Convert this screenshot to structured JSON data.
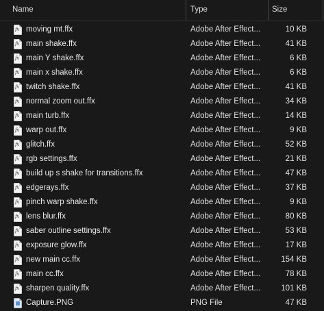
{
  "columns": {
    "name": "Name",
    "type": "Type",
    "size": "Size"
  },
  "files": [
    {
      "name": "moving mt.ffx",
      "type": "Adobe After Effect...",
      "size": "10 KB",
      "icon": "ffx-file-icon"
    },
    {
      "name": "main shake.ffx",
      "type": "Adobe After Effect...",
      "size": "41 KB",
      "icon": "ffx-file-icon"
    },
    {
      "name": "main Y shake.ffx",
      "type": "Adobe After Effect...",
      "size": "6 KB",
      "icon": "ffx-file-icon"
    },
    {
      "name": "main x shake.ffx",
      "type": "Adobe After Effect...",
      "size": "6 KB",
      "icon": "ffx-file-icon"
    },
    {
      "name": "twitch shake.ffx",
      "type": "Adobe After Effect...",
      "size": "41 KB",
      "icon": "ffx-file-icon"
    },
    {
      "name": "normal zoom out.ffx",
      "type": "Adobe After Effect...",
      "size": "34 KB",
      "icon": "ffx-file-icon"
    },
    {
      "name": "main turb.ffx",
      "type": "Adobe After Effect...",
      "size": "14 KB",
      "icon": "ffx-file-icon"
    },
    {
      "name": "warp out.ffx",
      "type": "Adobe After Effect...",
      "size": "9 KB",
      "icon": "ffx-file-icon"
    },
    {
      "name": "glitch.ffx",
      "type": "Adobe After Effect...",
      "size": "52 KB",
      "icon": "ffx-file-icon"
    },
    {
      "name": "rgb settings.ffx",
      "type": "Adobe After Effect...",
      "size": "21 KB",
      "icon": "ffx-file-icon"
    },
    {
      "name": "build up s shake for transitions.ffx",
      "type": "Adobe After Effect...",
      "size": "47 KB",
      "icon": "ffx-file-icon"
    },
    {
      "name": "edgerays.ffx",
      "type": "Adobe After Effect...",
      "size": "37 KB",
      "icon": "ffx-file-icon"
    },
    {
      "name": "pinch warp shake.ffx",
      "type": "Adobe After Effect...",
      "size": "9 KB",
      "icon": "ffx-file-icon"
    },
    {
      "name": "lens blur.ffx",
      "type": "Adobe After Effect...",
      "size": "80 KB",
      "icon": "ffx-file-icon"
    },
    {
      "name": "saber outline settings.ffx",
      "type": "Adobe After Effect...",
      "size": "53 KB",
      "icon": "ffx-file-icon"
    },
    {
      "name": "exposure glow.ffx",
      "type": "Adobe After Effect...",
      "size": "17 KB",
      "icon": "ffx-file-icon"
    },
    {
      "name": "new main cc.ffx",
      "type": "Adobe After Effect...",
      "size": "154 KB",
      "icon": "ffx-file-icon"
    },
    {
      "name": "main cc.ffx",
      "type": "Adobe After Effect...",
      "size": "78 KB",
      "icon": "ffx-file-icon"
    },
    {
      "name": "sharpen  quality.ffx",
      "type": "Adobe After Effect...",
      "size": "101 KB",
      "icon": "ffx-file-icon"
    },
    {
      "name": "Capture.PNG",
      "type": "PNG File",
      "size": "47 KB",
      "icon": "png-file-icon"
    }
  ],
  "colors": {
    "background": "#191919",
    "text": "#e6e6e6",
    "divider": "#4a4a4a"
  }
}
